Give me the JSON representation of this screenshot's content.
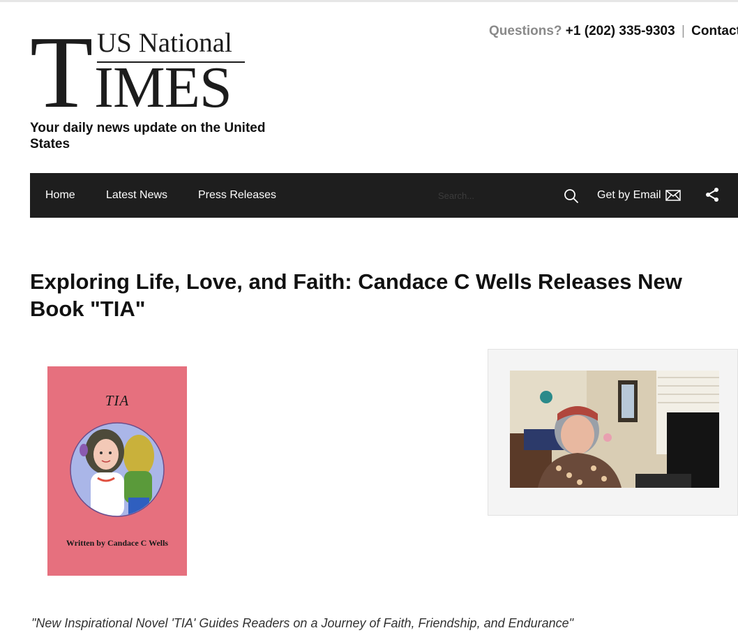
{
  "site": {
    "logo_top": "US National",
    "logo_t": "T",
    "logo_rest": "IMES",
    "tagline": "Your daily news update on the United States"
  },
  "contact_bar": {
    "question_label": "Questions?",
    "phone": "+1 (202) 335-9303",
    "separator": "|",
    "contact_label": "Contact"
  },
  "nav": {
    "items": [
      {
        "label": "Home"
      },
      {
        "label": "Latest News"
      },
      {
        "label": "Press Releases"
      }
    ],
    "search_placeholder": "Search...",
    "get_by_email": "Get by Email",
    "icons": [
      "search-icon",
      "email-icon",
      "share-icon"
    ]
  },
  "article": {
    "headline": "Exploring Life, Love, and Faith: Candace C Wells Releases New Book \"TIA\"",
    "cover": {
      "title": "TIA",
      "author_line": "Written by Candace C Wells",
      "background": "#e6707e"
    },
    "subheadline": "\"New Inspirational Novel 'TIA' Guides Readers on a Journey of Faith, Friendship, and Endurance\""
  },
  "colors": {
    "nav_background": "#1e1e1e",
    "question_gray": "#8a8a8a",
    "text": "#111111"
  }
}
